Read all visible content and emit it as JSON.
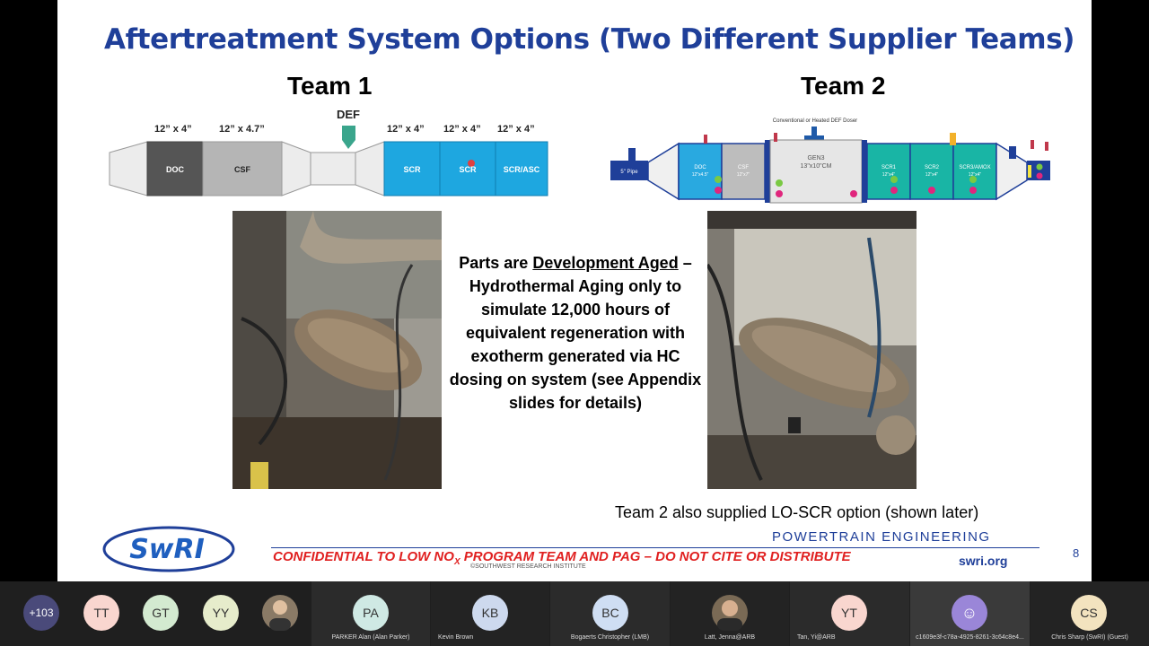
{
  "slide": {
    "title": "Aftertreatment System Options (Two Different Supplier Teams)",
    "team1": {
      "heading": "Team 1",
      "def_label": "DEF",
      "dimensions": [
        "12” x 4”",
        "12” x 4.7”",
        "12” x 4”",
        "12” x 4”",
        "12” x 4”"
      ],
      "components": [
        "DOC",
        "CSF",
        "SCR",
        "SCR",
        "SCR/ASC"
      ]
    },
    "team2": {
      "heading": "Team 2",
      "doser_label": "Conventional or Heated DEF Doser",
      "pipe_label": "5\" Pipe",
      "components": [
        {
          "name": "DOC",
          "size": "12\"x4.5\""
        },
        {
          "name": "CSF",
          "size": "12\"x7\""
        },
        {
          "name": "GEN3",
          "size": "13\"x10\"CM"
        },
        {
          "name": "SCR1",
          "size": "12\"x4\""
        },
        {
          "name": "SCR2",
          "size": "12\"x4\""
        },
        {
          "name": "SCR3/AMOX",
          "size": "12\"x4\""
        }
      ]
    },
    "center_text": {
      "prefix": "Parts are ",
      "underlined": "Development Aged",
      "suffix": " – Hydrothermal Aging only to simulate 12,000 hours of equivalent regeneration with exotherm generated via HC dosing on system (see Appendix slides for details)"
    },
    "note": "Team 2 also supplied LO-SCR option (shown later)",
    "footer": {
      "logo": "SwRI",
      "confidential_pre": "CONFIDENTIAL TO LOW NO",
      "confidential_sub": "X",
      "confidential_post": " PROGRAM TEAM AND PAG – DO NOT CITE OR DISTRIBUTE",
      "copyright": "©SOUTHWEST RESEARCH INSTITUTE",
      "division": "POWERTRAIN ENGINEERING",
      "url": "swri.org",
      "page": "8"
    }
  },
  "participants": {
    "overflow": "+103",
    "initials_only": [
      {
        "initials": "TT",
        "color": "#f9d6cf"
      },
      {
        "initials": "GT",
        "color": "#d3ead0"
      },
      {
        "initials": "YY",
        "color": "#e6eccb"
      }
    ],
    "named": [
      {
        "initials": "PA",
        "name": "PARKER Alan (Alan Parker)",
        "color": "#cfe9e4"
      },
      {
        "initials": "KB",
        "name": "Kevin Brown",
        "color": "#cdd9ee"
      },
      {
        "initials": "BC",
        "name": "Bogaerts Christopher (LMB)",
        "color": "#cfdef3"
      },
      {
        "initials": "",
        "name": "Latt, Jenna@ARB",
        "color": "#7a6a55"
      },
      {
        "initials": "YT",
        "name": "Tan, Yi@ARB",
        "color": "#f9d6cf"
      },
      {
        "initials": "",
        "name": "c1609e3f-c78a-4925-8261-3c64c8e4...",
        "color": "#9a86d8"
      },
      {
        "initials": "CS",
        "name": "Chris Sharp (SwRI) (Guest)",
        "color": "#f3e3bf"
      }
    ]
  }
}
